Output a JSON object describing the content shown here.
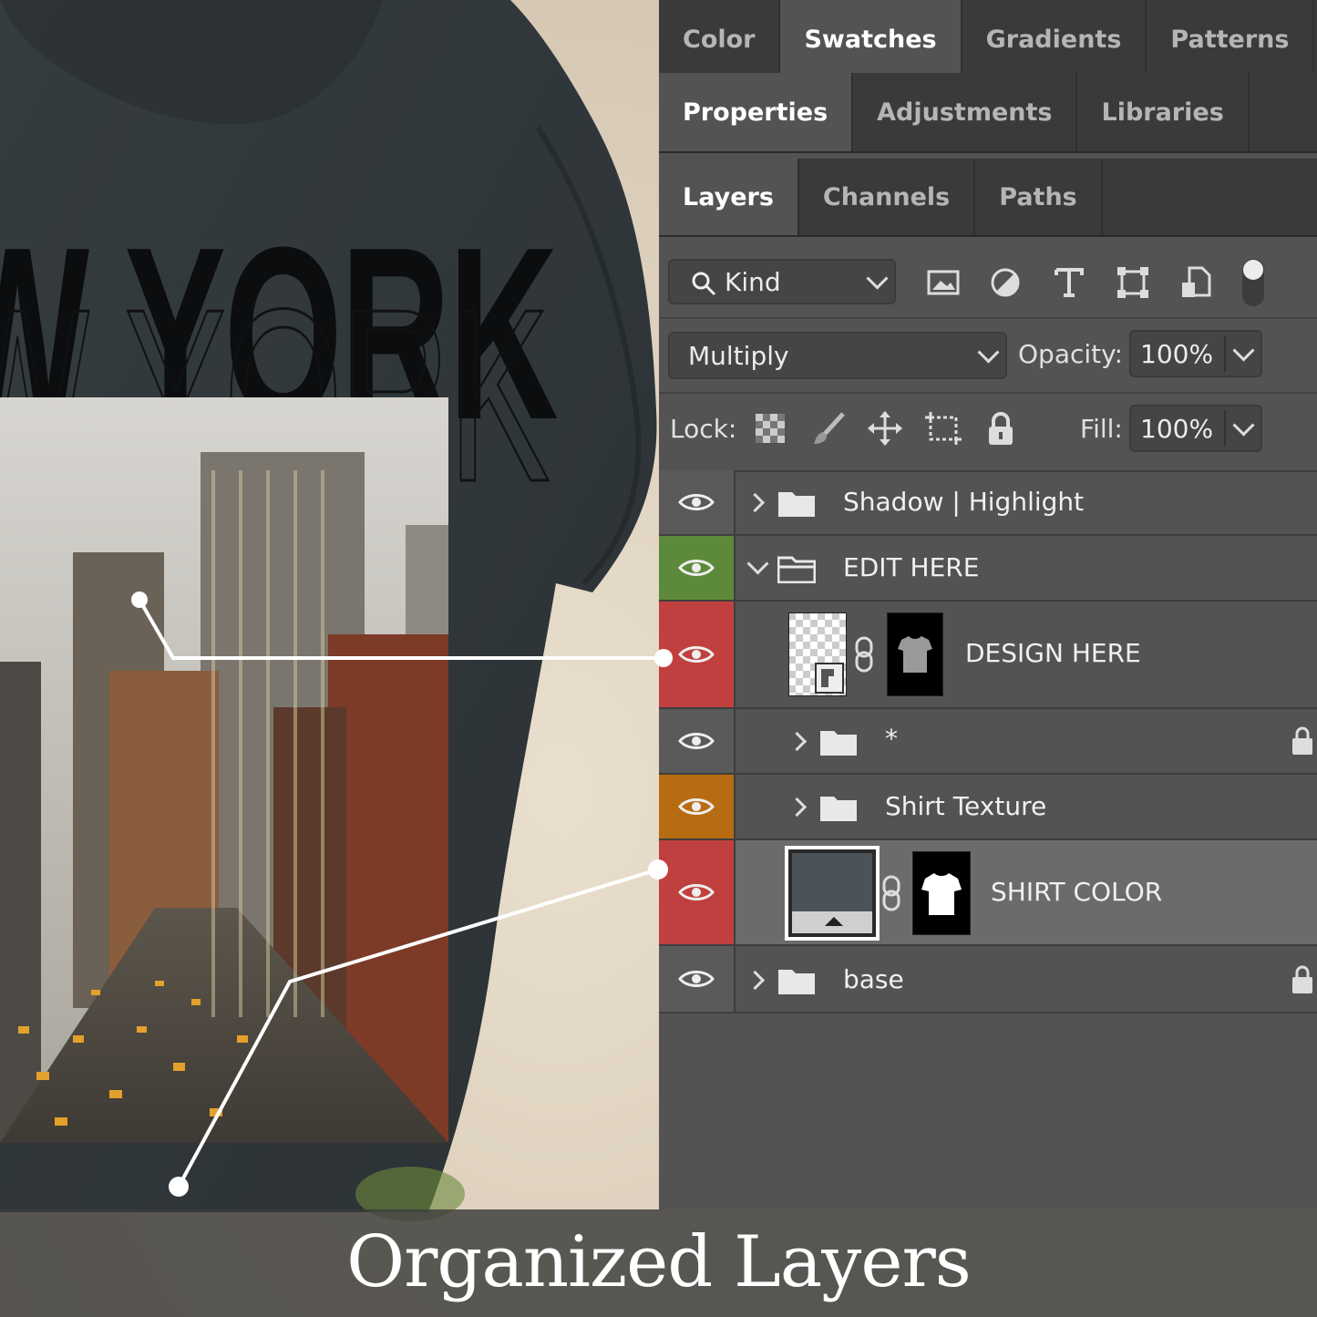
{
  "mockup": {
    "shirt_text": "W YORK",
    "caption": "Organized Layers"
  },
  "panel": {
    "tabs_row1": [
      "Color",
      "Swatches",
      "Gradients",
      "Patterns"
    ],
    "tabs_row2": [
      "Properties",
      "Adjustments",
      "Libraries"
    ],
    "tabs_row3": [
      "Layers",
      "Channels",
      "Paths"
    ],
    "filter": {
      "label": "Kind",
      "icon": "search-icon"
    },
    "filter_icons": [
      "image-filter-icon",
      "adjustment-filter-icon",
      "type-filter-icon",
      "shape-filter-icon",
      "smart-object-filter-icon"
    ],
    "blend_mode": "Multiply",
    "opacity_label": "Opacity:",
    "opacity_value": "100%",
    "lock_label": "Lock:",
    "lock_icons": [
      "lock-transparent-icon",
      "lock-image-icon",
      "lock-position-icon",
      "lock-artboard-icon",
      "lock-all-icon"
    ],
    "fill_label": "Fill:",
    "fill_value": "100%",
    "layers": [
      {
        "name": "Shadow | Highlight",
        "type": "group",
        "expanded": false,
        "eye_color": "#5a5a5a",
        "locked": false
      },
      {
        "name": "EDIT HERE",
        "type": "group",
        "expanded": true,
        "eye_color": "#5d8a3a",
        "locked": false
      },
      {
        "name": "DESIGN HERE",
        "type": "smart-object",
        "eye_color": "#c0403f",
        "locked": false
      },
      {
        "name": "*",
        "type": "group",
        "expanded": false,
        "eye_color": "#5a5a5a",
        "locked": true
      },
      {
        "name": "Shirt Texture",
        "type": "group",
        "expanded": false,
        "eye_color": "#b86c12",
        "locked": false
      },
      {
        "name": "SHIRT COLOR",
        "type": "fill",
        "eye_color": "#c0403f",
        "locked": false,
        "selected": true,
        "swatch": "#4b535a"
      },
      {
        "name": "base",
        "type": "group",
        "expanded": false,
        "eye_color": "#5a5a5a",
        "locked": true
      }
    ]
  }
}
